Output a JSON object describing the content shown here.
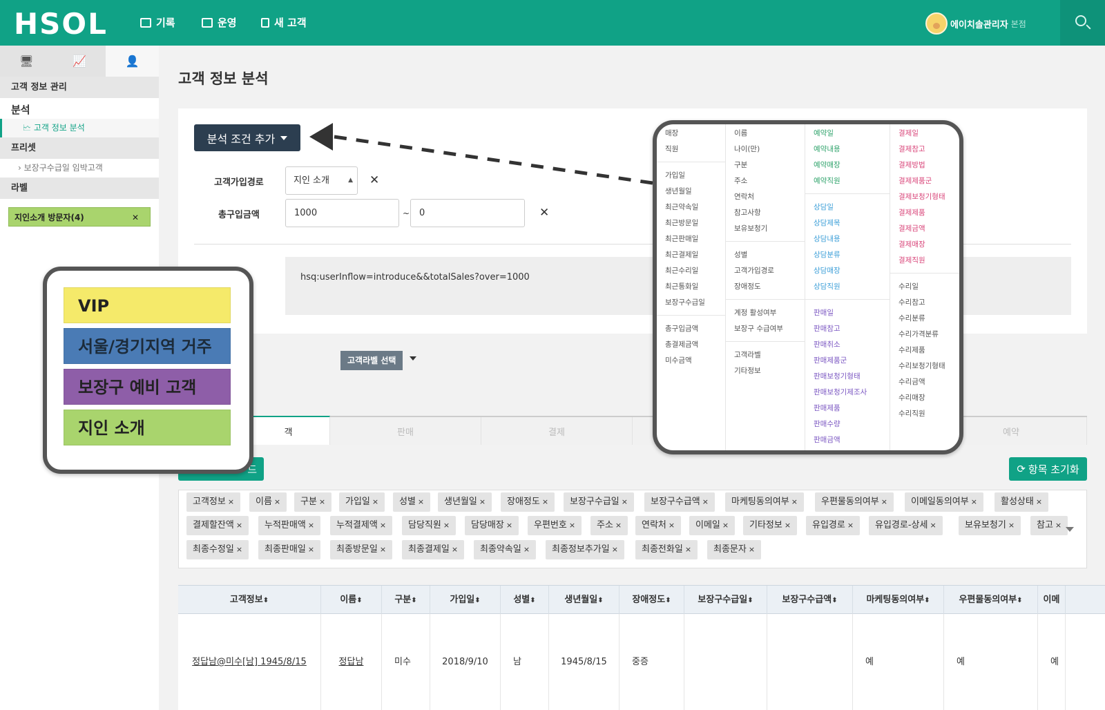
{
  "header": {
    "logo": "HSOL",
    "nav": [
      "기록",
      "운영",
      "새 고객"
    ],
    "user_name": "에이치솔관리자",
    "user_branch": "본점"
  },
  "sidebar": {
    "sections": {
      "customer_mgmt": "고객 정보 관리",
      "analysis": "분석",
      "analysis_item": "고객 정보 분석",
      "preset": "프리셋",
      "preset_item": "보장구수급일 임박고객",
      "label": "라벨"
    },
    "label_chip": "지인소개 방문자(4)"
  },
  "main": {
    "title": "고객 정보 분석",
    "add_condition": "분석 조건 추가",
    "cond1_label": "고객가입경로",
    "cond1_value": "지인 소개",
    "cond2_label": "총구입금액",
    "cond2_from": "1000",
    "cond2_to": "0",
    "tilde": "~",
    "query": "hsq:userInflow=introduce&&totalSales?over=1000",
    "label_select": "고객라벨 선택",
    "tabs": [
      "객",
      "판매",
      "결제",
      "예약"
    ],
    "reset_button": "항목 초기화",
    "download_button": "드"
  },
  "chips": [
    [
      "고객정보",
      "이름",
      "구분",
      "가입일",
      "성별",
      "생년월일",
      "장애정도",
      "보장구수급일",
      "보장구수급액",
      "마케팅동의여부",
      "우편물동의여부",
      "이메일동의여부",
      "활성상태"
    ],
    [
      "결제할잔액",
      "누적판매액",
      "누적결제액",
      "담당직원",
      "담당매장",
      "우편번호",
      "주소",
      "연락처",
      "이메일",
      "기타정보",
      "유입경로",
      "유입경로-상세",
      "보유보청기",
      "참고"
    ],
    [
      "최종수정일",
      "최종판매일",
      "최종방문일",
      "최종결제일",
      "최종약속일",
      "최종정보추가일",
      "최종전화일",
      "최종문자"
    ]
  ],
  "table": {
    "headers": [
      "고객정보",
      "이름",
      "구분",
      "가입일",
      "성별",
      "생년월일",
      "장애정도",
      "보장구수급일",
      "보장구수급액",
      "마케팅동의여부",
      "우편물동의여부",
      "이메"
    ],
    "row": [
      "정답남@미수[남] 1945/8/15",
      "정답남",
      "미수",
      "2018/9/10",
      "남",
      "1945/8/15",
      "중증",
      "",
      "",
      "예",
      "예",
      "예"
    ],
    "sort_glyph": "⬍"
  },
  "labels_callout": [
    {
      "text": "VIP",
      "color": "#f5ea6a"
    },
    {
      "text": "서울/경기지역 거주",
      "color": "#4a7bb5"
    },
    {
      "text": "보장구 예비 고객",
      "color": "#8e5ea8"
    },
    {
      "text": "지인 소개",
      "color": "#a9d46d"
    }
  ],
  "menu_callout": {
    "col1": {
      "group1": [
        "매장",
        "직원"
      ],
      "group2": [
        "가입일",
        "생년월일",
        "최근약속일",
        "최근방문일",
        "최근판매일",
        "최근결제일",
        "최근수리일",
        "최근통화일",
        "보장구수급일"
      ],
      "group3": [
        "총구입금액",
        "총결제금액",
        "미수금액"
      ]
    },
    "col2": {
      "group1": [
        "이름",
        "나이(만)",
        "구분",
        "주소",
        "연락처",
        "참고사항",
        "보유보청기"
      ],
      "group2": [
        "성별",
        "고객가입경로",
        "장애정도"
      ],
      "group3": [
        "계정 활성여부",
        "보장구 수급여부"
      ],
      "group4": [
        "고객라벨",
        "기타정보"
      ]
    },
    "col3": {
      "group1": [
        "예약일",
        "예약내용",
        "예약매장",
        "예약직원"
      ],
      "group2": [
        "상담일",
        "상담제목",
        "상담내용",
        "상담분류",
        "상담매장",
        "상담직원"
      ],
      "group3": [
        "판매일",
        "판매참고",
        "판매취소",
        "판매제품군",
        "판매보청기형태",
        "판매보청기제조사",
        "판매제품",
        "판매수량",
        "판매금액"
      ]
    },
    "col4": {
      "group1": [
        "결제일",
        "결제참고",
        "결제방법",
        "결제제품군",
        "결제보청기형태",
        "결제제품",
        "결제금액",
        "결제매장",
        "결제직원"
      ],
      "group2": [
        "수리일",
        "수리참고",
        "수리분류",
        "수리가격분류",
        "수리제품",
        "수리보청기형태",
        "수리금액",
        "수리매장",
        "수리직원"
      ]
    },
    "colors": {
      "col1": "#555555",
      "col2": "#555555",
      "col3_g1": "#2fa36b",
      "col3_g2": "#3d9fd8",
      "col3_g3": "#7b57c2",
      "col4_g1": "#d9467a",
      "col4_g2": "#555555"
    }
  },
  "colors": {
    "brand": "#10a286",
    "dark_button": "#2c3e50"
  }
}
